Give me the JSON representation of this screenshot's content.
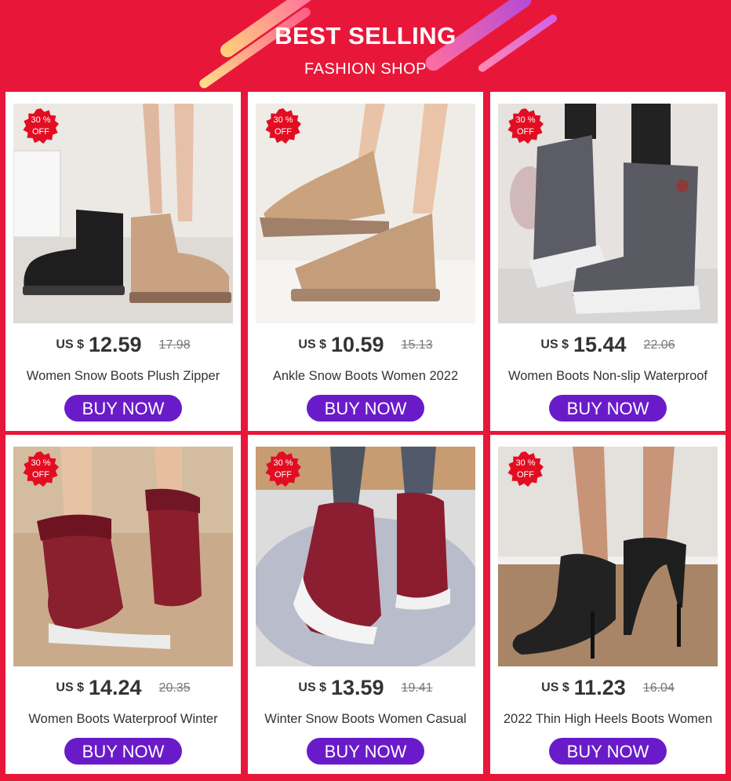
{
  "header": {
    "title": "BEST SELLING",
    "subtitle": "FASHION SHOP"
  },
  "colors": {
    "background": "#e8173a",
    "button": "#6a1bc9",
    "badge": "#e30d22"
  },
  "products": [
    {
      "badge_line1": "30 %",
      "badge_line2": "OFF",
      "currency": "US $",
      "price": "12.59",
      "old_price": "17.98",
      "name": "Women Snow Boots Plush Zipper",
      "button": "BUY NOW"
    },
    {
      "badge_line1": "30 %",
      "badge_line2": "OFF",
      "currency": "US $",
      "price": "10.59",
      "old_price": "15.13",
      "name": "Ankle Snow Boots Women 2022",
      "button": "BUY NOW"
    },
    {
      "badge_line1": "30 %",
      "badge_line2": "OFF",
      "currency": "US $",
      "price": "15.44",
      "old_price": "22.06",
      "name": "Women Boots Non-slip Waterproof",
      "button": "BUY NOW"
    },
    {
      "badge_line1": "30 %",
      "badge_line2": "OFF",
      "currency": "US $",
      "price": "14.24",
      "old_price": "20.35",
      "name": "Women Boots Waterproof Winter",
      "button": "BUY NOW"
    },
    {
      "badge_line1": "30 %",
      "badge_line2": "OFF",
      "currency": "US $",
      "price": "13.59",
      "old_price": "19.41",
      "name": "Winter Snow Boots Women Casual",
      "button": "BUY NOW"
    },
    {
      "badge_line1": "30 %",
      "badge_line2": "OFF",
      "currency": "US $",
      "price": "11.23",
      "old_price": "16.04",
      "name": "2022 Thin High Heels Boots Women",
      "button": "BUY NOW"
    }
  ]
}
